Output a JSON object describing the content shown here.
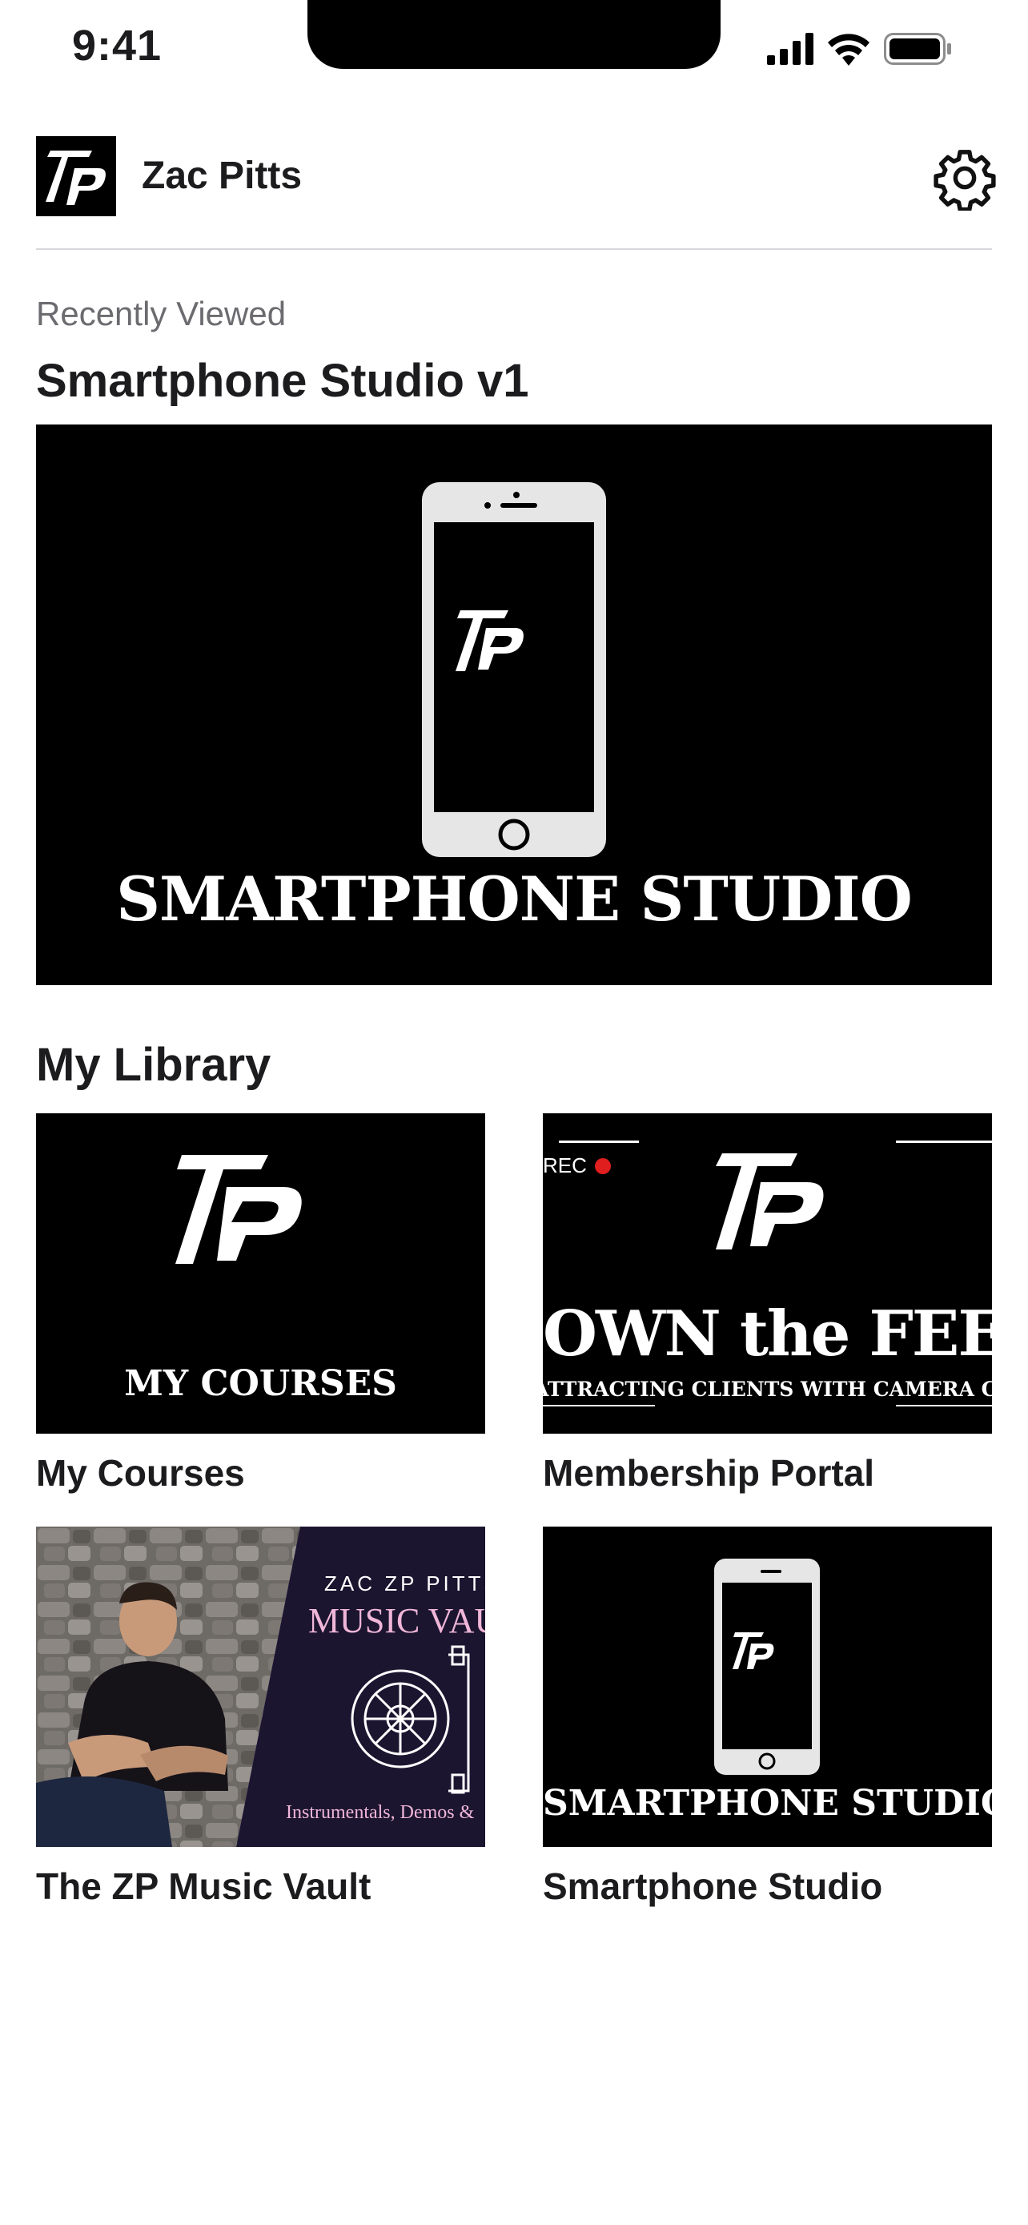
{
  "status_bar": {
    "time": "9:41"
  },
  "header": {
    "user_name": "Zac Pitts"
  },
  "recent": {
    "section_label": "Recently Viewed",
    "title": "Smartphone Studio v1",
    "banner_text": "SMARTPHONE STUDIO"
  },
  "library": {
    "title": "My Library",
    "items": [
      {
        "label": "My Courses",
        "thumb_text": "MY COURSES"
      },
      {
        "label": "Membership Portal",
        "thumb_rec": "REC",
        "thumb_title": "OWN the FEED",
        "thumb_subtitle": "ATTRACTING CLIENTS WITH CAMERA CONFIDENCE"
      },
      {
        "label": "The ZP Music Vault",
        "thumb_brand": "ZAC ZP PITTS",
        "thumb_title": "MUSIC VAULT",
        "thumb_subtitle": "Instrumentals, Demos &"
      },
      {
        "label": "Smartphone Studio",
        "thumb_text": "SMARTPHONE STUDIO"
      }
    ]
  },
  "colors": {
    "accent": "#000000",
    "rec_dot": "#e01e1e",
    "vault_pink": "#f0b6d8",
    "vault_bg": "#1c1530"
  }
}
